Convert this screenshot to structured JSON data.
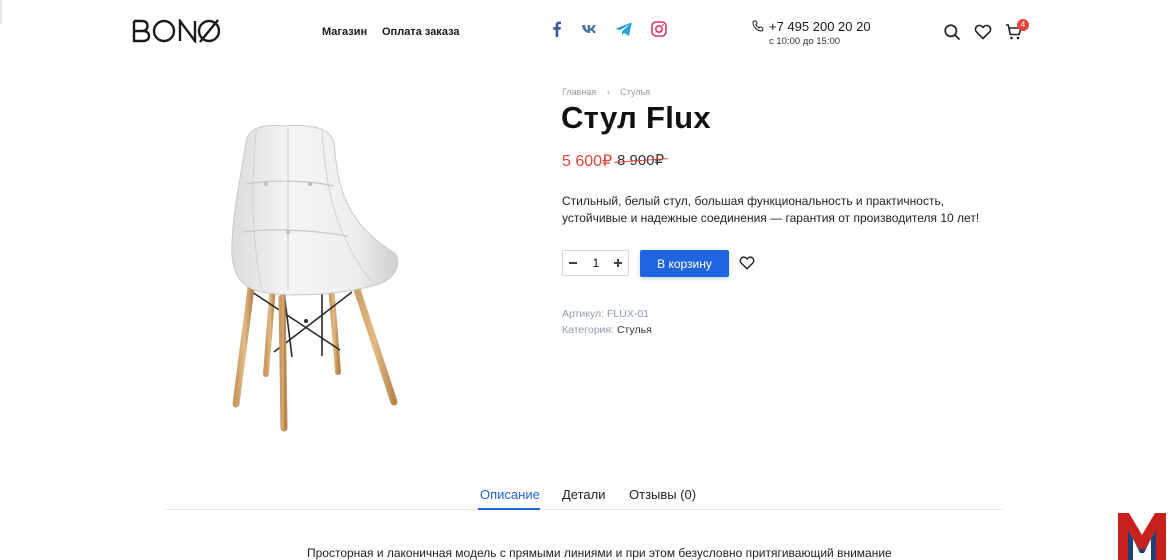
{
  "header": {
    "logo_text": "BONØ",
    "nav": [
      "Магазин",
      "Оплата заказа"
    ],
    "social": [
      "facebook-icon",
      "vk-icon",
      "telegram-icon",
      "instagram-icon"
    ],
    "phone": "+7 495 200 20 20",
    "hours": "с 10:00 до 15:00",
    "cart_count": "4"
  },
  "breadcrumb": {
    "home": "Главная",
    "category": "Стулья"
  },
  "product": {
    "title": "Стул Flux",
    "price_new": "5 600₽",
    "price_old": "8 900₽",
    "description": "Стильный, белый стул, большая функциональность и практичность, устойчивые и надежные соединения — гарантия от производителя 10 лет!",
    "quantity": "1",
    "add_to_cart": "В корзину",
    "sku_label": "Артикул:",
    "sku": "FLUX-01",
    "category_label": "Категория:",
    "category": "Стулья"
  },
  "tabs": [
    "Описание",
    "Детали",
    "Отзывы (0)"
  ],
  "description_text": "Просторная и лаконичная модель с прямыми линиями и при этом безусловно притягивающий внимание",
  "colors": {
    "accent": "#1f65e0",
    "price": "#e4443b",
    "badge": "#e4443b"
  }
}
